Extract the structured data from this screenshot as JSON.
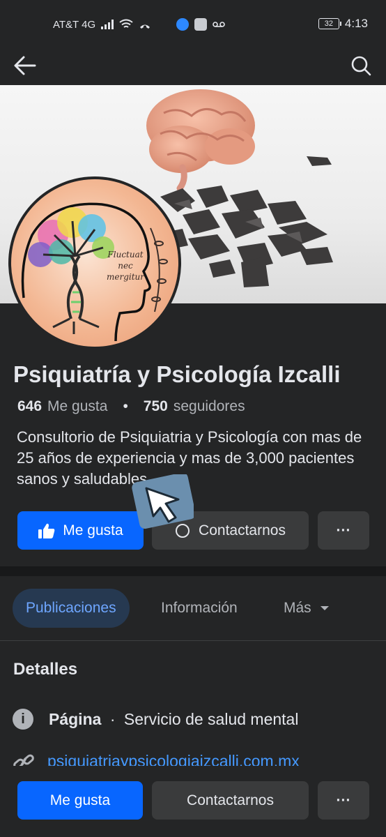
{
  "status_bar": {
    "carrier": "AT&T 4G",
    "battery": "32",
    "time": "4:13"
  },
  "nav": {
    "back_icon": "back-arrow-icon",
    "search_icon": "search-icon"
  },
  "profile": {
    "name": "Psiquiatría y Psicología Izcalli",
    "likes_count": "646",
    "likes_label": "Me gusta",
    "separator": "•",
    "followers_count": "750",
    "followers_label": "seguidores",
    "bio": "Consultorio de Psiquiatria y Psicología con mas de 25 años de experiencia y mas de 3,000 pacientes sanos y saludables",
    "avatar_text_line1": "Fluctuat",
    "avatar_text_line2": "nec",
    "avatar_text_line3": "mergitur"
  },
  "actions": {
    "like_label": "Me gusta",
    "contact_label": "Contactarnos",
    "more_label": "···"
  },
  "tabs": [
    {
      "label": "Publicaciones",
      "active": true
    },
    {
      "label": "Información",
      "active": false
    },
    {
      "label": "Más",
      "active": false
    }
  ],
  "details": {
    "title": "Detalles",
    "category_label": "Página",
    "category_separator": "·",
    "category_value": "Servicio de salud mental",
    "website": "psiquiatriaypsicologiaizcalli.com.mx"
  },
  "sticky": {
    "like_label": "Me gusta",
    "contact_label": "Contactarnos",
    "more_label": "···"
  },
  "colors": {
    "background": "#242526",
    "primary": "#0866ff",
    "secondary_button": "#3a3b3c",
    "active_tab_bg": "#263951",
    "active_tab_text": "#6ea6ff",
    "link": "#4599ff"
  }
}
